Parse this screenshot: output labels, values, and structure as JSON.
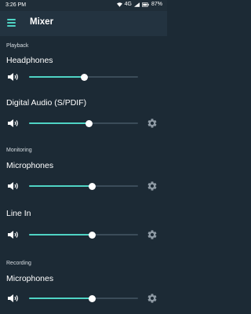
{
  "status_bar": {
    "time": "3:26 PM",
    "network": "4G",
    "battery": "87%"
  },
  "app_bar": {
    "title": "Mixer",
    "menu_icon": "hamburger-menu-icon"
  },
  "colors": {
    "background": "#1c2a35",
    "app_bar": "#233340",
    "accent": "#4fd3c4",
    "track": "#3b4c59"
  },
  "sections": [
    {
      "title": "Playback",
      "channels": [
        {
          "label": "Headphones",
          "level": 0.51,
          "settings": false
        },
        {
          "label": "Digital Audio (S/PDIF)",
          "level": 0.55,
          "settings": true
        }
      ]
    },
    {
      "title": "Monitoring",
      "channels": [
        {
          "label": "Microphones",
          "level": 0.58,
          "settings": true
        },
        {
          "label": "Line In",
          "level": 0.58,
          "settings": true
        }
      ]
    },
    {
      "title": "Recording",
      "channels": [
        {
          "label": "Microphones",
          "level": 0.58,
          "settings": true
        }
      ]
    }
  ]
}
